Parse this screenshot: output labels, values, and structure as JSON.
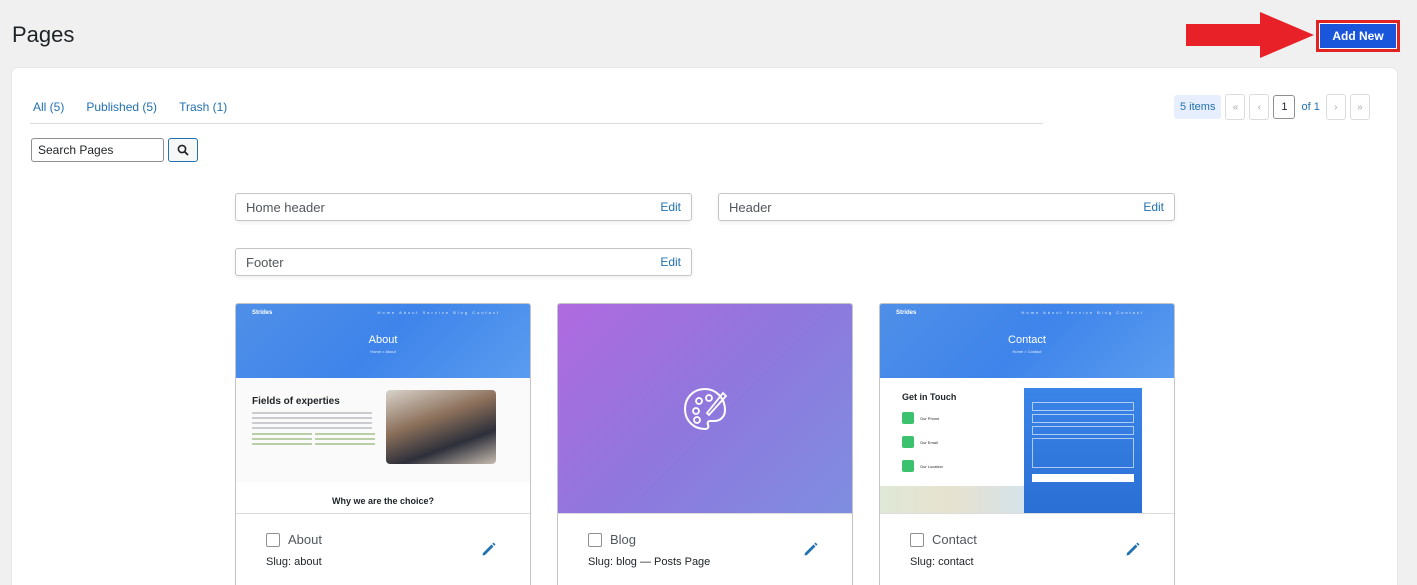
{
  "header": {
    "title": "Pages",
    "add_new_label": "Add New"
  },
  "filters": [
    {
      "label": "All (5)"
    },
    {
      "label": "Published (5)"
    },
    {
      "label": "Trash (1)"
    }
  ],
  "pagination": {
    "count": "5 items",
    "first": "«",
    "prev": "‹",
    "current_page": "1",
    "of_label": "of 1",
    "next": "›",
    "last": "»"
  },
  "search": {
    "placeholder": "Search Pages"
  },
  "template_parts": [
    {
      "name": "Home header",
      "edit_label": "Edit"
    },
    {
      "name": "Header",
      "edit_label": "Edit"
    },
    {
      "name": "Footer",
      "edit_label": "Edit"
    }
  ],
  "pages": [
    {
      "title": "About",
      "slug": "Slug: about",
      "thumb": {
        "brand": "Strides",
        "menu": "Home  About  Service  Blog  Contact",
        "heading": "About",
        "crumb": "Home  >  About",
        "section_title": "Fields of experties",
        "footer_title": "Why we are the choice?"
      }
    },
    {
      "title": "Blog",
      "slug": "Slug: blog — Posts Page"
    },
    {
      "title": "Contact",
      "slug": "Slug: contact",
      "thumb": {
        "brand": "Strides",
        "menu": "Home  About  Service  Blog  Contact",
        "heading": "Contact",
        "crumb": "Home  >  Contact",
        "section_title": "Get in Touch",
        "info": [
          "Our Phone",
          "Our Email",
          "Our Location"
        ]
      }
    }
  ],
  "colors": {
    "accent": "#2271b1",
    "add_new_bg": "#1a56db",
    "highlight": "#e02424"
  }
}
